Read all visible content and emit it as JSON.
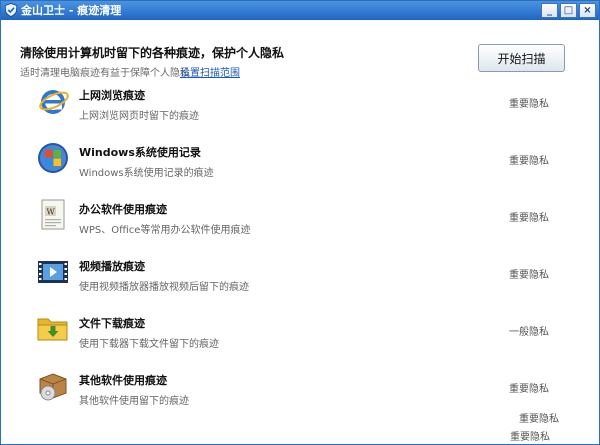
{
  "window": {
    "title": "金山卫士 - 痕迹清理",
    "min_glyph": "_",
    "max_glyph": "□",
    "close_glyph": "×"
  },
  "header": {
    "title": "清除使用计算机时留下的各种痕迹，保护个人隐私",
    "subtitle": "适时清理电脑痕迹有益于保障个人隐私",
    "settings_link": "设置扫描范围",
    "scan_button": "开始扫描"
  },
  "items": [
    {
      "name": "上网浏览痕迹",
      "desc": "上网浏览网页时留下的痕迹",
      "level": "重要隐私",
      "icon": "ie-browser-icon"
    },
    {
      "name": "Windows系统使用记录",
      "desc": "Windows系统使用记录的痕迹",
      "level": "重要隐私",
      "icon": "windows-logo-icon"
    },
    {
      "name": "办公软件使用痕迹",
      "desc": "WPS、Office等常用办公软件使用痕迹",
      "level": "重要隐私",
      "icon": "document-icon"
    },
    {
      "name": "视频播放痕迹",
      "desc": "使用视频播放器播放视频后留下的痕迹",
      "level": "重要隐私",
      "icon": "video-film-icon"
    },
    {
      "name": "文件下载痕迹",
      "desc": "使用下载器下载文件留下的痕迹",
      "level": "一般隐私",
      "icon": "download-folder-icon"
    },
    {
      "name": "其他软件使用痕迹",
      "desc": "其他软件使用留下的痕迹",
      "level": "重要隐私",
      "icon": "software-box-icon"
    }
  ],
  "overflow_labels": [
    "重要隐私",
    "重要隐私"
  ],
  "colors": {
    "titlebar": "#2a6fbf",
    "link": "#1a58b9"
  }
}
